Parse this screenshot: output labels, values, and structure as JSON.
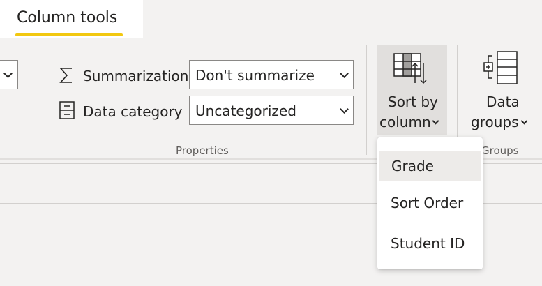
{
  "tab": {
    "label": "Column tools",
    "accent_color": "#f2c811"
  },
  "properties": {
    "summarization": {
      "label": "Summarization",
      "value": "Don't summarize",
      "icon": "sigma-icon"
    },
    "data_category": {
      "label": "Data category",
      "value": "Uncategorized",
      "icon": "data-category-icon"
    },
    "group_label": "Properties"
  },
  "sort_by_column": {
    "line1": "Sort by",
    "line2": "column",
    "icon": "sort-by-column-icon"
  },
  "data_groups": {
    "line1": "Data",
    "line2": "groups",
    "icon": "data-groups-icon",
    "group_label": "Groups"
  },
  "sort_menu": {
    "items": [
      {
        "label": "Grade",
        "selected": true
      },
      {
        "label": "Sort Order",
        "selected": false
      },
      {
        "label": "Student ID",
        "selected": false
      }
    ]
  }
}
